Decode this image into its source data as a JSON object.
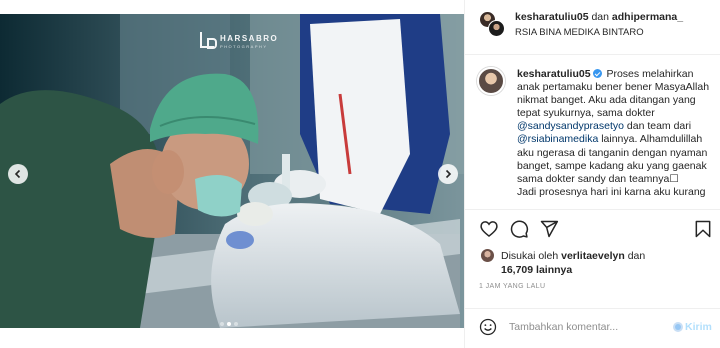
{
  "photo": {
    "watermark_brand": "HARSABRO",
    "watermark_tagline": "PHOTOGRAPHY",
    "carousel_total": 3,
    "carousel_active": 1
  },
  "header": {
    "user1": "kesharatuliu05",
    "conjunction": "dan",
    "user2": "adhipermana_",
    "location": "RSIA BINA MEDIKA BINTARO"
  },
  "caption": {
    "username": "kesharatuliu05",
    "text_part1": "Proses melahirkan anak pertamaku bener bener MasyaAllah nikmat banget. Aku ada ditangan yang tepat syukurnya, sama dokter ",
    "mention1": "@sandysandyprasetyo",
    "text_part2": " dan team dari ",
    "mention2": "@rsiabinamedika",
    "text_part3": " lainnya. Alhamdulillah aku ngerasa di tanganin dengan nyaman banget, sampe kadang aku yang gaenak sama dokter sandy dan teamnya☐",
    "text_part4": "Jadi prosesnya hari ini karna aku kurang"
  },
  "likes": {
    "prefix": "Disukai oleh",
    "user": "verlitaevelyn",
    "middle": "dan",
    "count": "16,709 lainnya"
  },
  "timestamp": "1 JAM YANG LALU",
  "comment": {
    "placeholder": "Tambahkan komentar...",
    "post_label": "Kirim"
  },
  "icons": {
    "like": "heart-icon",
    "comment": "comment-icon",
    "share": "share-icon",
    "save": "bookmark-icon",
    "emoji": "emoji-icon",
    "prev": "chevron-left-icon",
    "next": "chevron-right-icon"
  },
  "colors": {
    "mention": "#00376b",
    "verified": "#3897f0",
    "scrub": "#2b5a4a",
    "cap": "#4fa98b",
    "mask": "#8fd1c8"
  }
}
